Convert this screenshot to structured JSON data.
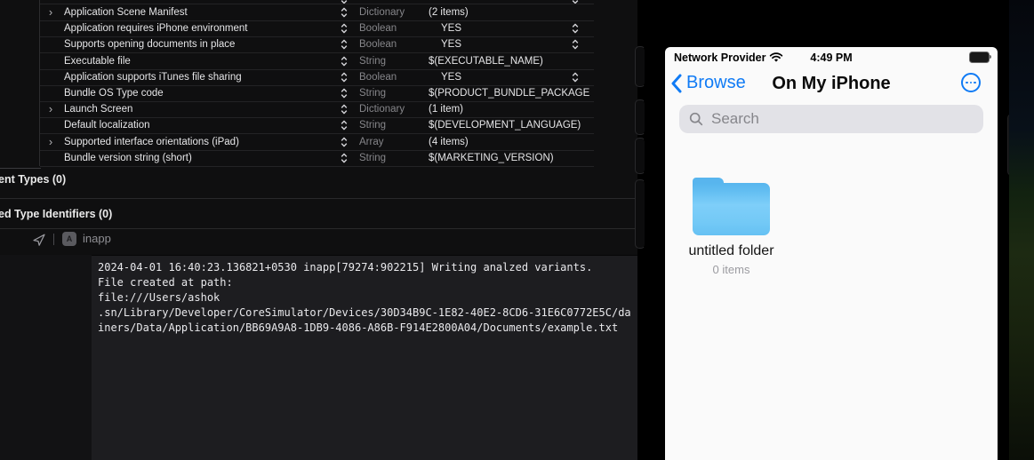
{
  "xcode": {
    "plist": {
      "rows": [
        {
          "key": "",
          "type": "",
          "value": "",
          "disclosure": false,
          "value_stepper": true,
          "partial": true
        },
        {
          "key": "Application Scene Manifest",
          "type": "Dictionary",
          "value": "(2 items)",
          "disclosure": true,
          "value_stepper": false
        },
        {
          "key": "Application requires iPhone environment",
          "type": "Boolean",
          "value": "YES",
          "disclosure": false,
          "value_stepper": true
        },
        {
          "key": "Supports opening documents in place",
          "type": "Boolean",
          "value": "YES",
          "disclosure": false,
          "value_stepper": true
        },
        {
          "key": "Executable file",
          "type": "String",
          "value": "$(EXECUTABLE_NAME)",
          "disclosure": false,
          "value_stepper": false
        },
        {
          "key": "Application supports iTunes file sharing",
          "type": "Boolean",
          "value": "YES",
          "disclosure": false,
          "value_stepper": true
        },
        {
          "key": "Bundle OS Type code",
          "type": "String",
          "value": "$(PRODUCT_BUNDLE_PACKAGE",
          "disclosure": false,
          "value_stepper": false
        },
        {
          "key": "Launch Screen",
          "type": "Dictionary",
          "value": "(1 item)",
          "disclosure": true,
          "value_stepper": false
        },
        {
          "key": "Default localization",
          "type": "String",
          "value": "$(DEVELOPMENT_LANGUAGE)",
          "disclosure": false,
          "value_stepper": false
        },
        {
          "key": "Supported interface orientations (iPad)",
          "type": "Array",
          "value": "(4 items)",
          "disclosure": true,
          "value_stepper": false
        },
        {
          "key": "Bundle version string (short)",
          "type": "String",
          "value": "$(MARKETING_VERSION)",
          "disclosure": false,
          "value_stepper": false
        }
      ]
    },
    "sections": [
      {
        "label": "ent Types (0)"
      },
      {
        "label": "ed Type Identifiers (0)"
      }
    ],
    "console": {
      "process_badge": "inapp",
      "lines": [
        "2024-04-01 16:40:23.136821+0530 inapp[79274:902215] Writing analzed variants.",
        "File created at path:",
        "file:///Users/ashok",
        ".sn/Library/Developer/CoreSimulator/Devices/30D34B9C-1E82-40E2-8CD6-31E6C0772E5C/da",
        "iners/Data/Application/BB69A9A8-1DB9-4086-A86B-F914E2800A04/Documents/example.txt"
      ]
    }
  },
  "simulator": {
    "status_bar": {
      "carrier": "Network Provider",
      "time": "4:49 PM"
    },
    "nav_bar": {
      "back_label": "Browse",
      "title": "On My iPhone"
    },
    "search": {
      "placeholder": "Search"
    },
    "items": [
      {
        "name": "untitled folder",
        "meta": "0 items"
      }
    ]
  },
  "colors": {
    "ios_blue": "#107BF5",
    "folder_top": "#58B5EE",
    "folder_body": "#79CCF8",
    "xcode_bg": "#0F0F10",
    "console_bg": "#1D1D20",
    "muted_gray": "#8E8E93"
  }
}
